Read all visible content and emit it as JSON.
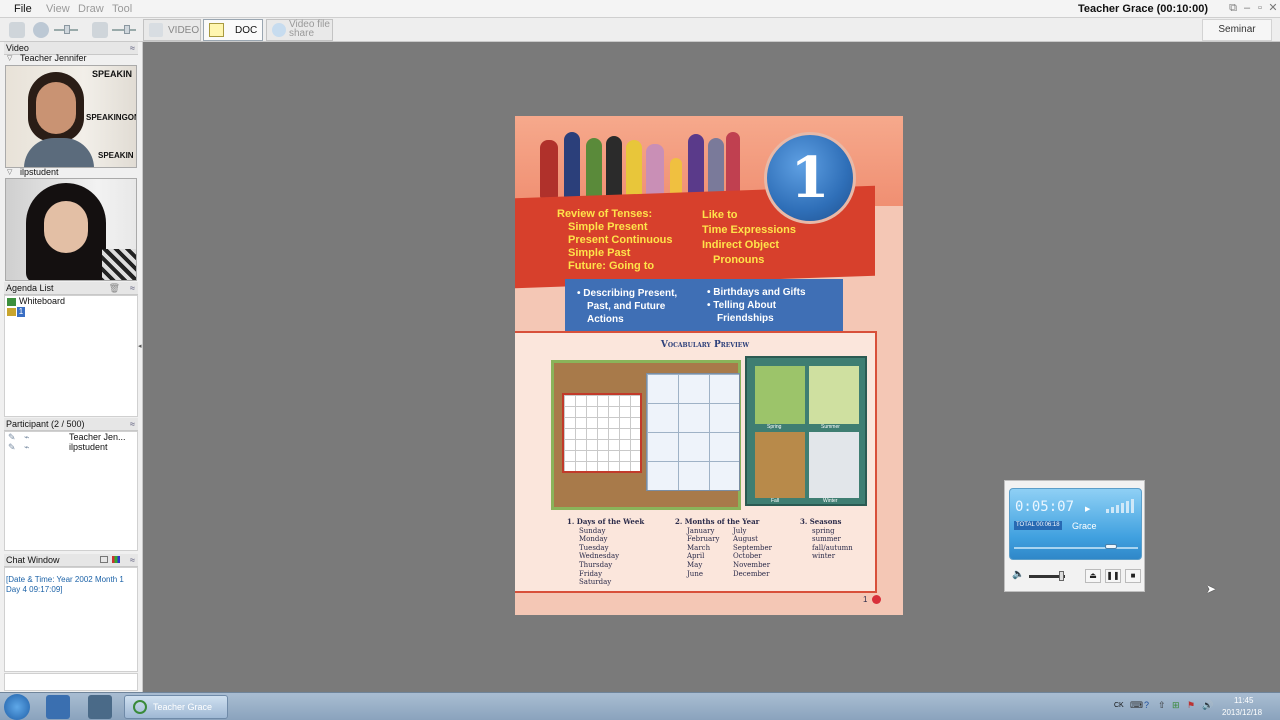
{
  "menu": {
    "file": "File",
    "view": "View",
    "draw": "Draw",
    "tool": "Tool"
  },
  "window": {
    "title": "Teacher Grace (00:10:00)"
  },
  "toolbar": {
    "video_tab": "VIDEO",
    "doc_tab": "DOC",
    "video_file_share_line1": "Video  file",
    "video_file_share_line2": "share",
    "seminar_button": "Seminar"
  },
  "video_panel": {
    "title": "Video",
    "feeds": [
      {
        "name": "Teacher Jennifer",
        "banner1": "SPEAKIN",
        "banner2": "SPEAKINGON",
        "banner3": "SPEAKIN"
      },
      {
        "name": "ilpstudent"
      }
    ]
  },
  "agenda_panel": {
    "title": "Agenda List",
    "items": [
      "Whiteboard",
      "1"
    ]
  },
  "participant_panel": {
    "title": "Participant (2 / 500)",
    "rows": [
      "Teacher Jen...",
      "ilpstudent"
    ]
  },
  "chat_panel": {
    "title": "Chat Window",
    "messages": [
      "[Date & Time: Year 2002 Month 1 Day 4 09:17:09]"
    ]
  },
  "document": {
    "unit_number": "1",
    "left_topics": [
      "Review of Tenses:",
      "Simple Present",
      "Present Continuous",
      "Simple Past",
      "Future: Going to"
    ],
    "right_topics": [
      "Like to",
      "Time Expressions",
      "Indirect Object",
      "Pronouns"
    ],
    "goals_left": [
      "• Describing Present,",
      "Past, and Future",
      "Actions"
    ],
    "goals_right": [
      "• Birthdays and Gifts",
      "• Telling About",
      "Friendships"
    ],
    "vocab_title": "Vocabulary Preview",
    "vocab_columns": [
      {
        "heading": "1.  Days of the Week",
        "items": [
          "Sunday",
          "Monday",
          "Tuesday",
          "Wednesday",
          "Thursday",
          "Friday",
          "Saturday"
        ]
      },
      {
        "heading": "2.  Months of the Year",
        "items": [
          "January",
          "February",
          "March",
          "April",
          "May",
          "June"
        ],
        "items2": [
          "July",
          "August",
          "September",
          "October",
          "November",
          "December"
        ]
      },
      {
        "heading": "3.  Seasons",
        "items": [
          "spring",
          "summer",
          "fall/autumn",
          "winter"
        ]
      }
    ],
    "season_labels": [
      "Spring",
      "Summer",
      "Fall",
      "Winter"
    ],
    "page_number": "1"
  },
  "player": {
    "time": "0:05:07",
    "total_label": "TOTAL",
    "total_time": "00:06:18",
    "speaker": "Grace"
  },
  "taskbar": {
    "active_task": "Teacher Grace",
    "tray_lang": "CK",
    "clock_time": "11:45",
    "clock_date": "2013/12/18"
  },
  "colors": {
    "doc_background": "#7a7a7a",
    "banner_red": "#d7402c",
    "badge_blue": "#2f6fb8",
    "topic_yellow": "#ffe34a"
  }
}
